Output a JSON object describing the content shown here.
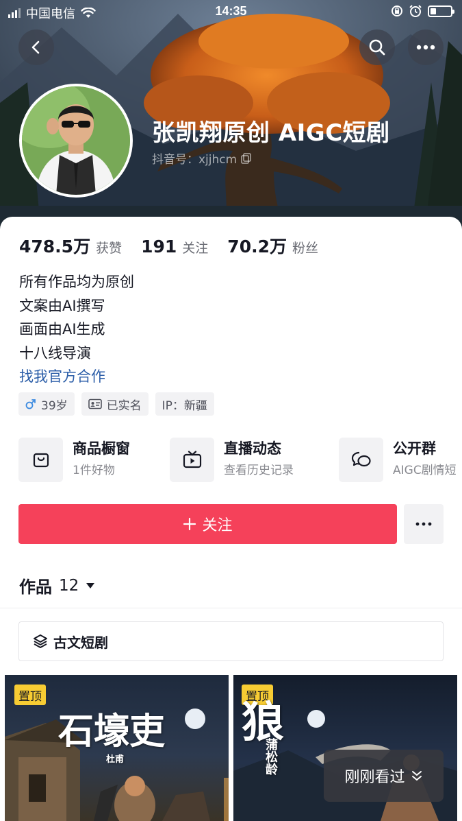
{
  "status_bar": {
    "carrier": "中国电信",
    "time": "14:35"
  },
  "profile": {
    "nickname": "张凯翔原创 AIGC短剧",
    "douyin_id": "抖音号：xjjhcm"
  },
  "stats": [
    {
      "value": "478.5万",
      "label": "获赞"
    },
    {
      "value": "191",
      "label": "关注"
    },
    {
      "value": "70.2万",
      "label": "粉丝"
    }
  ],
  "bio": {
    "lines": [
      "所有作品均为原创",
      "文案由AI撰写",
      "画面由AI生成",
      "十八线导演"
    ],
    "link": "找我官方合作"
  },
  "tags": {
    "age": "39岁",
    "verified": "已实名",
    "ip": "IP：新疆"
  },
  "features": [
    {
      "title": "商品橱窗",
      "subtitle": "1件好物",
      "icon": "bag-icon"
    },
    {
      "title": "直播动态",
      "subtitle": "查看历史记录",
      "icon": "tv-icon"
    },
    {
      "title": "公开群",
      "subtitle": "AIGC剧情短",
      "icon": "chat-icon"
    }
  ],
  "actions": {
    "follow_label": "关注"
  },
  "works": {
    "label": "作品",
    "count": "12"
  },
  "collection": {
    "label": "古文短剧"
  },
  "videos": [
    {
      "pin_label": "置顶",
      "title": "石壕吏",
      "author": "杜甫"
    },
    {
      "pin_label": "置顶",
      "title": "狼",
      "author": "蒲松龄"
    }
  ],
  "recent": {
    "label": "刚刚看过"
  },
  "colors": {
    "accent": "#f5415a",
    "link": "#2c5ea8",
    "pin": "#f7cc33"
  }
}
